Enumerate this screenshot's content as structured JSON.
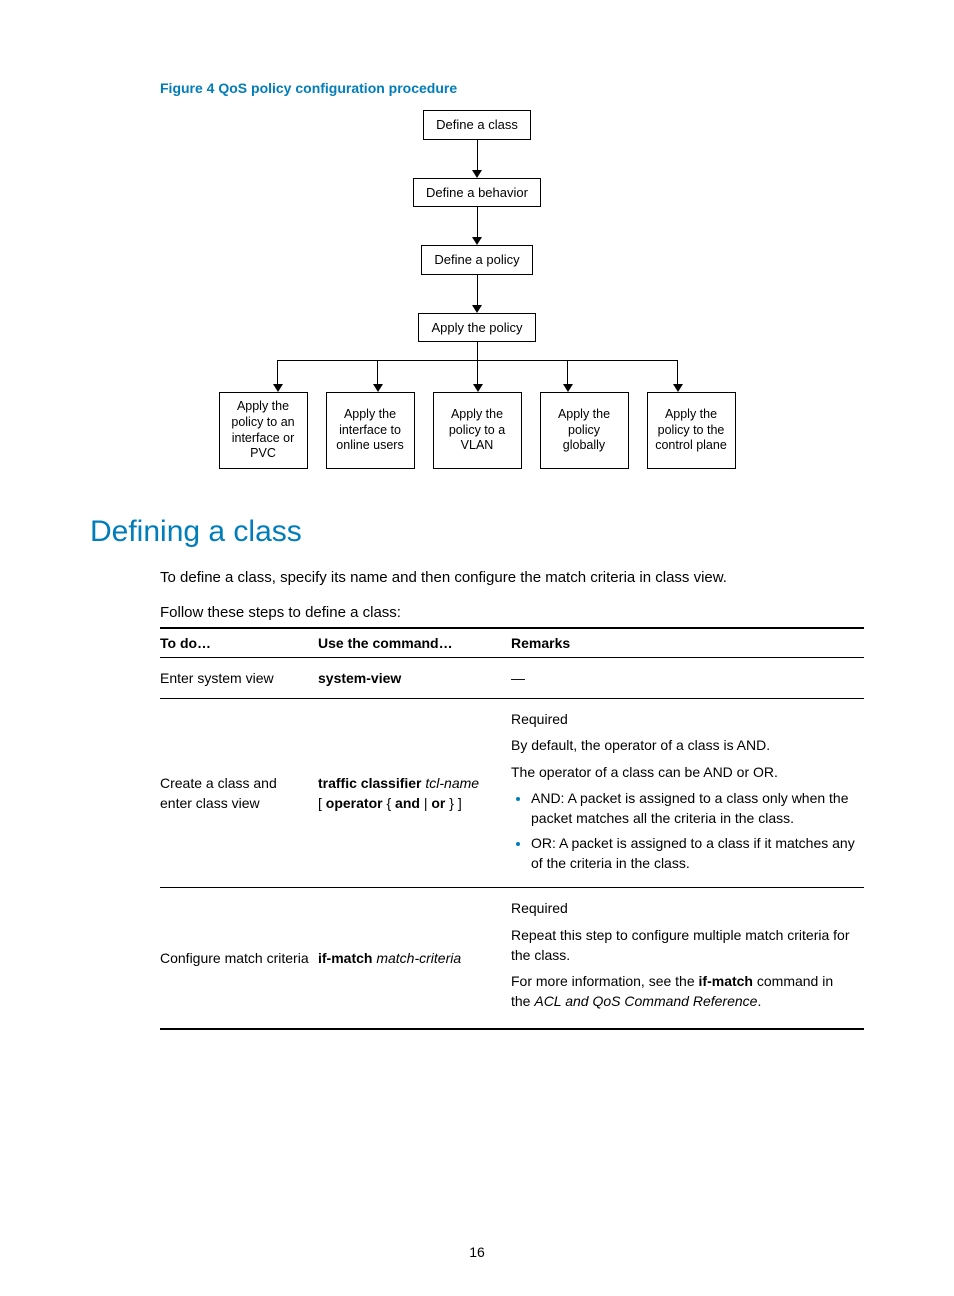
{
  "figureCaption": "Figure 4 QoS policy configuration procedure",
  "flow": {
    "step1": "Define a class",
    "step2": "Define a behavior",
    "step3": "Define a policy",
    "step4": "Apply the policy",
    "branches": [
      "Apply the policy to an interface or PVC",
      "Apply the interface to online users",
      "Apply the policy to a VLAN",
      "Apply the policy globally",
      "Apply the policy to the control plane"
    ]
  },
  "heading": "Defining a class",
  "para1": "To define a class, specify its name and then configure the match criteria in class view.",
  "para2": "Follow these steps to define a class:",
  "table": {
    "headers": {
      "todo": "To do…",
      "cmd": "Use the command…",
      "remarks": "Remarks"
    },
    "rows": [
      {
        "todo": "Enter system view",
        "cmd_html": "<b>system-view</b>",
        "remarks_html": "—"
      },
      {
        "todo": "Create a class and enter class view",
        "cmd_html": "<b>traffic classifier</b> <i>tcl-name</i><br>[ <b>operator</b> { <b>and</b> | <b>or</b> } ]",
        "remarks_html": "<div class='remark-block'><p>Required</p><p>By default, the operator of a class is AND.</p><p>The operator of a class can be AND or OR.</p><ul class='bullets'><li>AND: A packet is assigned to a class only when the packet matches all the criteria in the class.</li><li>OR: A packet is assigned to a class if it matches any of the criteria in the class.</li></ul></div>"
      },
      {
        "todo": "Configure match criteria",
        "cmd_html": "<b>if-match</b> <i>match-criteria</i>",
        "remarks_html": "<div class='remark-block'><p>Required</p><p>Repeat this step to configure multiple match criteria for the class.</p><p>For more information, see the <b>if-match</b> command in the <i>ACL and QoS Command Reference</i>.</p></div>"
      }
    ]
  },
  "pageNumber": "16"
}
